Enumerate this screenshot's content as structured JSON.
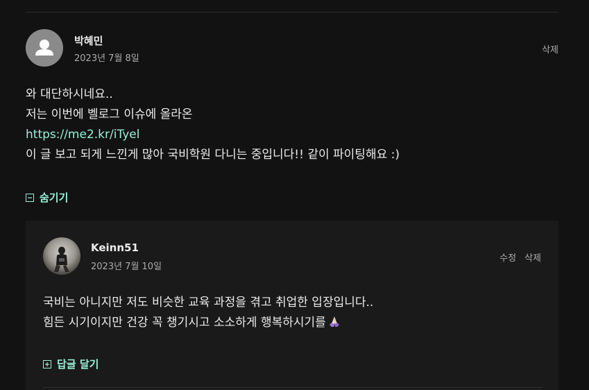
{
  "comment": {
    "author": "박혜민",
    "date": "2023년 7월 8일",
    "delete_label": "삭제",
    "body": {
      "line1": "와 대단하시네요..",
      "line2": "저는 이번에 벨로그 이슈에 올라온",
      "link": "https://me2.kr/iTyel",
      "line4": "이 글 보고 되게 느낀게 많아 국비학원 다니는 중입니다!! 같이 파이팅해요 :)"
    },
    "toggle_label": "숨기기"
  },
  "reply": {
    "author": "Keinn51",
    "date": "2023년 7월 10일",
    "edit_label": "수정",
    "delete_label": "삭제",
    "body": {
      "line1": "국비는 아니지만 저도 비슷한 교육 과정을 겪고 취업한 입장입니다..",
      "line2": "힘든 시기이지만 건강 꼭 챙기시고 소소하게 행복하시기를"
    },
    "emoji": "folded-hands-emoji",
    "write_reply_label": "답글 달기"
  },
  "colors": {
    "background": "#121212",
    "accent": "#96f2d7",
    "text": "#ececec",
    "muted": "#acacac",
    "reply_background": "#1a1a1a"
  }
}
